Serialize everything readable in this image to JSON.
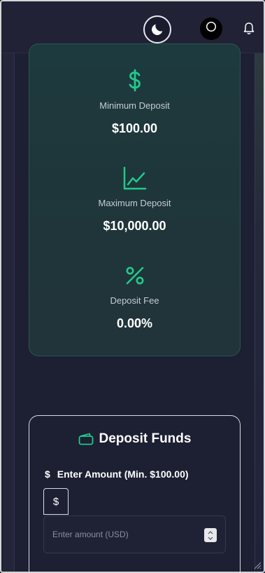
{
  "header": {
    "theme_toggle_icon": "moon-icon",
    "avatar_icon": "user-avatar-icon",
    "notification_icon": "bell-icon"
  },
  "stats": {
    "accent_color": "#22c98b",
    "items": [
      {
        "icon": "dollar-icon",
        "label": "Minimum Deposit",
        "value": "$100.00"
      },
      {
        "icon": "chart-line-icon",
        "label": "Maximum Deposit",
        "value": "$10,000.00"
      },
      {
        "icon": "percent-icon",
        "label": "Deposit Fee",
        "value": "0.00%"
      }
    ]
  },
  "deposit": {
    "icon": "wallet-icon",
    "title": "Deposit Funds",
    "amount_label_icon": "$",
    "amount_label": "Enter Amount (Min. $100.00)",
    "currency_prefix": "$",
    "amount_placeholder": "Enter amount (USD)",
    "amount_value": ""
  }
}
